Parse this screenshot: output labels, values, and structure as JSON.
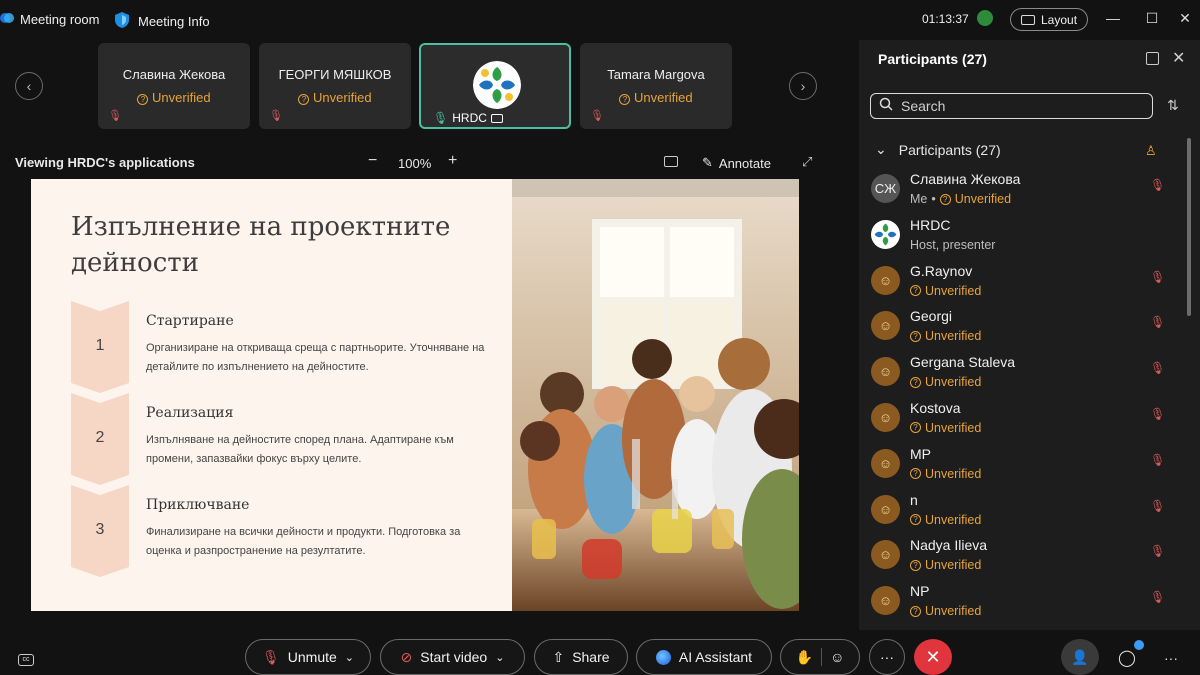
{
  "topbar": {
    "meeting_room": "Meeting room",
    "meeting_info": "Meeting Info",
    "timer": "01:13:37",
    "layout": "Layout"
  },
  "strip": {
    "tiles": [
      {
        "name": "Славина Жекова",
        "status": "Unverified"
      },
      {
        "name": "ГЕОРГИ МЯШКОВ",
        "status": "Unverified"
      },
      {
        "name": "HRDC"
      },
      {
        "name": "Tamara Margova",
        "status": "Unverified"
      }
    ]
  },
  "viewbar": {
    "viewing": "Viewing HRDC's applications",
    "zoom": "100%",
    "annotate": "Annotate"
  },
  "slide": {
    "title": "Изпълнение на проектните дейности",
    "steps": [
      {
        "num": "1",
        "head": "Стартиране",
        "desc": "Организиране на откриваща среща с партньорите. Уточняване на детайлите по изпълнението на дейностите."
      },
      {
        "num": "2",
        "head": "Реализация",
        "desc": "Изпълняване на дейностите според плана. Адаптиране към промени, запазвайки фокус върху целите."
      },
      {
        "num": "3",
        "head": "Приключване",
        "desc": "Финализиране на всички дейности и продукти. Подготовка за оценка и разпространение на резултатите."
      }
    ]
  },
  "panel": {
    "title": "Participants (27)",
    "search_placeholder": "Search",
    "group_label": "Participants (27)",
    "participants": [
      {
        "name": "Славина Жекова",
        "initials": "СЖ",
        "me": "Me",
        "status": "Unverified"
      },
      {
        "name": "HRDC",
        "role": "Host, presenter"
      },
      {
        "name": "G.Raynov",
        "status": "Unverified"
      },
      {
        "name": "Georgi",
        "status": "Unverified"
      },
      {
        "name": "Gergana Staleva",
        "status": "Unverified"
      },
      {
        "name": "Kostova",
        "status": "Unverified"
      },
      {
        "name": "MP",
        "status": "Unverified"
      },
      {
        "name": "n",
        "status": "Unverified"
      },
      {
        "name": "Nadya Ilieva",
        "status": "Unverified"
      },
      {
        "name": "NP",
        "status": "Unverified"
      }
    ]
  },
  "bottombar": {
    "unmute": "Unmute",
    "start_video": "Start video",
    "share": "Share",
    "ai_assistant": "AI Assistant"
  }
}
